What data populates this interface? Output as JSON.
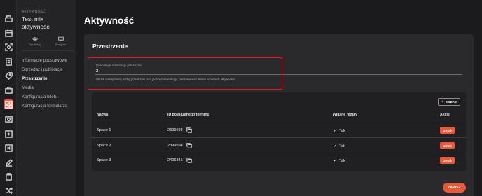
{
  "rail": {
    "icons": [
      "dashboard-icon",
      "calendar-icon",
      "focus-icon",
      "reservation-icon",
      "tag-icon",
      "ticket-icon",
      "activity-icon",
      "gallery-icon",
      "voucher-icon",
      "close-square-icon",
      "edit-icon",
      "clipboard-icon",
      "shuffle-icon"
    ],
    "active": "activity-icon",
    "accent_color": "#e8583a"
  },
  "sidebar": {
    "eyebrow": "AKTYWNOŚĆ",
    "title": "Test mix aktywności",
    "actions": [
      {
        "label": "Opublikuj",
        "icon": "eye-icon"
      },
      {
        "label": "Podgląd",
        "icon": "monitor-icon"
      }
    ],
    "nav": [
      {
        "label": "Informacje podstawowe",
        "active": false
      },
      {
        "label": "Sprzedaż i publikacja",
        "active": false
      },
      {
        "label": "Przestrzenie",
        "active": true
      },
      {
        "label": "Media",
        "active": false
      },
      {
        "label": "Konfiguracja biletu",
        "active": false
      },
      {
        "label": "Konfiguracja formularza",
        "active": false
      }
    ]
  },
  "main": {
    "page_title": "Aktywność",
    "section_title": "Przestrzenie",
    "field": {
      "label": "Równoległe rezerwacje przestrzeni",
      "value": "2",
      "help": "Określ maksymalną liczbę przestrzeni jaką jednocześnie mogą zarezerwować klienci w ramach aktywności."
    },
    "add_button": "DODAJ",
    "table": {
      "headers": {
        "name": "Nazwa",
        "term_id": "ID powiązanego terminu",
        "rules": "Własne reguły",
        "actions": "Akcje"
      },
      "rows": [
        {
          "name": "Space 1",
          "term_id": "2399593",
          "rules": "Tak",
          "delete": "USUŃ"
        },
        {
          "name": "Space 2",
          "term_id": "2399594",
          "rules": "Tak",
          "delete": "USUŃ"
        },
        {
          "name": "Space 3",
          "term_id": "2406345",
          "rules": "Tak",
          "delete": "USUŃ"
        }
      ]
    },
    "save_button": "ZAPISZ",
    "highlight_color": "#d61f2a"
  }
}
